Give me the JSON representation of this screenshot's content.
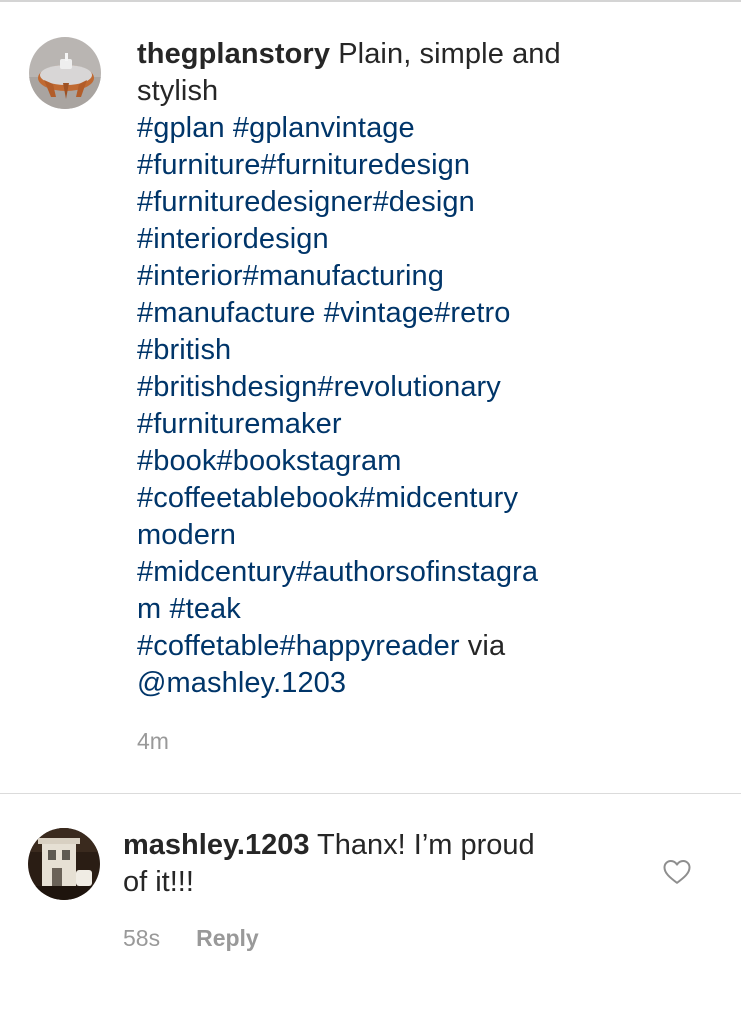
{
  "post": {
    "username": "thegplanstory",
    "caption_text_1": "Plain, simple and",
    "caption_text_2": "stylish",
    "lines": [
      [
        "#gplan",
        " ",
        "#gplanvintage"
      ],
      [
        "#furniture",
        "#furnituredesign"
      ],
      [
        "#furnituredesigner",
        "#design"
      ],
      [
        "#interiordesign"
      ],
      [
        "#interior",
        "#manufacturing"
      ],
      [
        "#manufacture",
        " ",
        "#vintage",
        "#retro"
      ],
      [
        "#british"
      ],
      [
        "#britishdesign",
        "#revolutionary"
      ],
      [
        "#furnituremaker"
      ],
      [
        "#book",
        "#bookstagram"
      ],
      [
        "#coffeetablebook",
        "#midcentury"
      ],
      [
        "modern"
      ],
      [
        "#midcentury",
        "#authorsofinstagra"
      ],
      [
        "m",
        " ",
        "#teak"
      ]
    ],
    "last_line_tags": [
      "#coffetable",
      "#happyreader"
    ],
    "via_text": " via",
    "via_mention": "@mashley.1203",
    "time": "4m"
  },
  "comment": {
    "username": "mashley.1203",
    "text_1": "Thanx! I’m proud",
    "text_2": "of it!!!",
    "time": "58s",
    "reply_label": "Reply",
    "like_icon": "heart-outline-icon"
  },
  "colors": {
    "hashtag": "#003569",
    "text": "#262626",
    "meta": "#999999",
    "divider": "#dbdbdb"
  }
}
